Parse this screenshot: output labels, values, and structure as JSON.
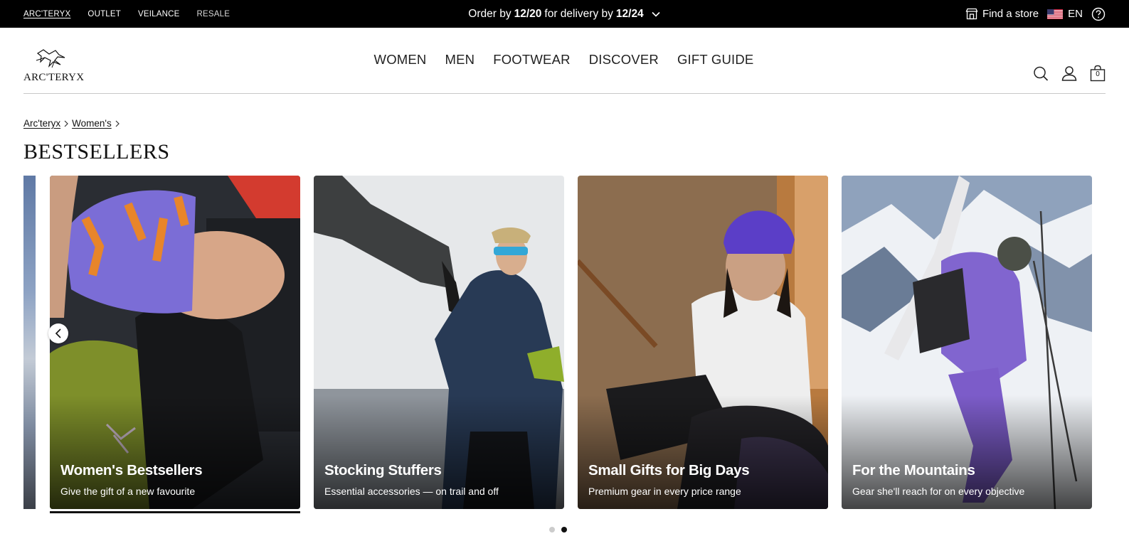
{
  "topbar": {
    "brands": [
      {
        "label": "ARC'TERYX",
        "active": true
      },
      {
        "label": "OUTLET",
        "active": false
      },
      {
        "label": "VEILANCE",
        "active": false
      },
      {
        "label": "RESALE",
        "active": false
      }
    ],
    "promo": {
      "part1": "Order by",
      "date1": "12/20",
      "part2": "for delivery by",
      "date2": "12/24"
    },
    "find_store": "Find a store",
    "language": "EN"
  },
  "header": {
    "logo_text": "ARC'TERYX",
    "nav": [
      "WOMEN",
      "MEN",
      "FOOTWEAR",
      "DISCOVER",
      "GIFT GUIDE"
    ],
    "bag_count": "0"
  },
  "breadcrumb": [
    "Arc'teryx",
    "Women's"
  ],
  "page_title": "BESTSELLERS",
  "cards": [
    {
      "title": "Women's Bestsellers",
      "subtitle": "Give the gift of a new favourite"
    },
    {
      "title": "Stocking Stuffers",
      "subtitle": "Essential accessories — on trail and off"
    },
    {
      "title": "Small Gifts for Big Days",
      "subtitle": "Premium gear in every price range"
    },
    {
      "title": "For the Mountains",
      "subtitle": "Gear she'll reach for on every objective"
    }
  ],
  "carousel": {
    "active_page": 2,
    "pages": 2
  },
  "colors": {
    "topbar_bg": "#000000",
    "accent": "#111111"
  }
}
